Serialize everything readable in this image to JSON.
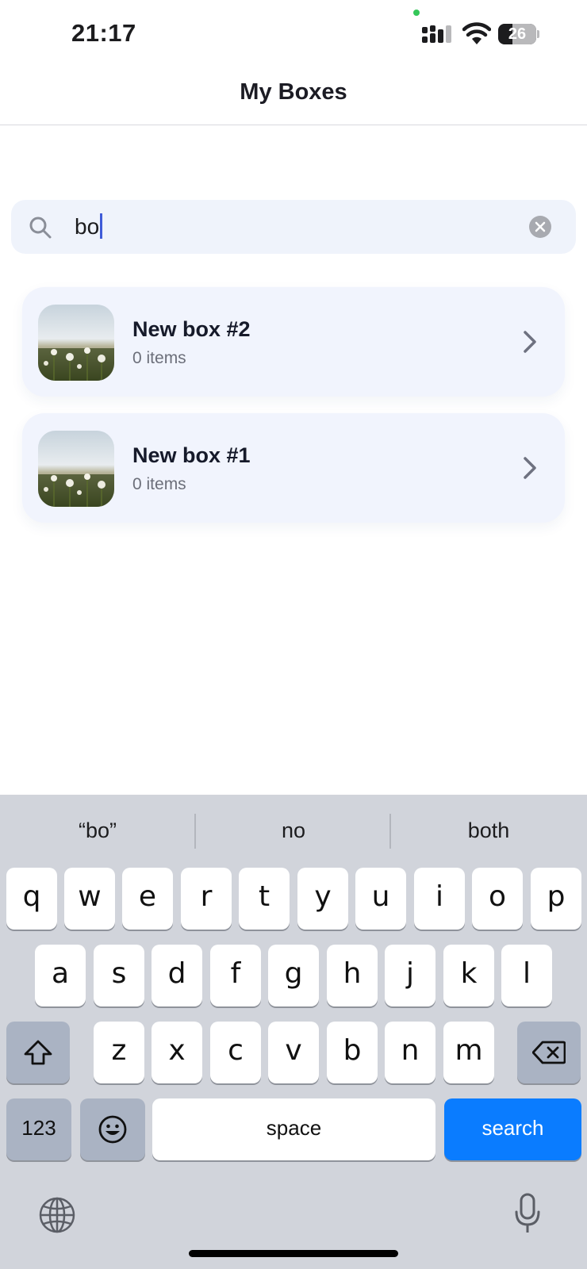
{
  "status_bar": {
    "time": "21:17",
    "battery": "26"
  },
  "nav": {
    "title": "My Boxes"
  },
  "search": {
    "value": "bo"
  },
  "boxes": [
    {
      "title": "New box #2",
      "subtitle": "0 items"
    },
    {
      "title": "New box #1",
      "subtitle": "0 items"
    }
  ],
  "keyboard": {
    "suggestions": [
      "“bo”",
      "no",
      "both"
    ],
    "row1": [
      "q",
      "w",
      "e",
      "r",
      "t",
      "y",
      "u",
      "i",
      "o",
      "p"
    ],
    "row2": [
      "a",
      "s",
      "d",
      "f",
      "g",
      "h",
      "j",
      "k",
      "l"
    ],
    "row3": [
      "z",
      "x",
      "c",
      "v",
      "b",
      "n",
      "m"
    ],
    "numbers_label": "123",
    "space_label": "space",
    "search_label": "search"
  },
  "colors": {
    "accent": "#0a7cff",
    "card_bg": "#f1f4fd",
    "search_bg": "#eff3fb",
    "keyboard_bg": "#d1d4db"
  },
  "icons": [
    "signal-icon",
    "wifi-icon",
    "battery-icon",
    "search-icon",
    "clear-icon",
    "chevron-right-icon",
    "shift-icon",
    "backspace-icon",
    "emoji-icon",
    "globe-icon",
    "microphone-icon"
  ]
}
